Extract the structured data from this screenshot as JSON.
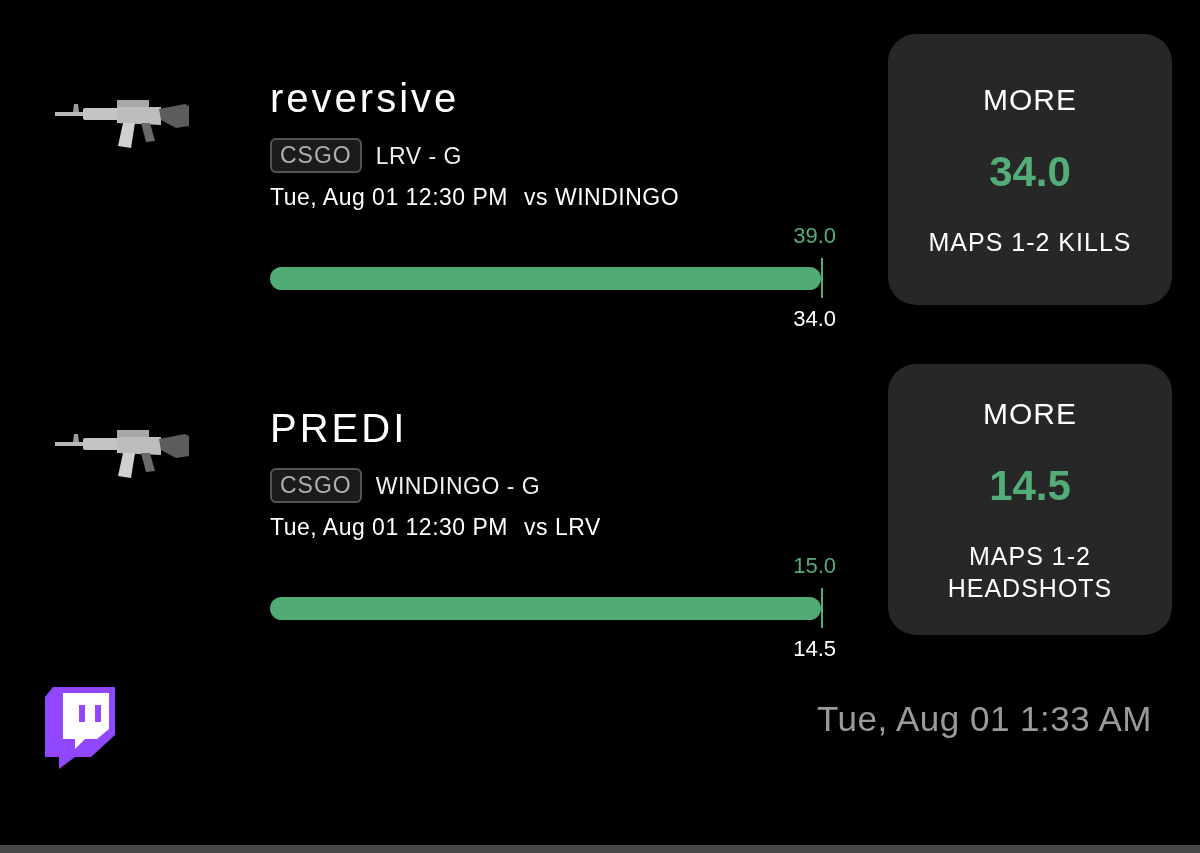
{
  "props": [
    {
      "player": "reversive",
      "game": "CSGO",
      "team": "LRV - G",
      "match_time": "Tue, Aug 01 12:30 PM",
      "opponent": "vs WINDINGO",
      "bar": {
        "top_value": "39.0",
        "level": 1,
        "bottom_value": "34.0"
      },
      "pick": {
        "direction": "MORE",
        "line": "34.0",
        "stat": "MAPS 1-2 KILLS"
      }
    },
    {
      "player": "PREDI",
      "game": "CSGO",
      "team": "WINDINGO - G",
      "match_time": "Tue, Aug 01 12:30 PM",
      "opponent": "vs LRV",
      "bar": {
        "top_value": "15.0",
        "level": 1,
        "bottom_value": "14.5"
      },
      "pick": {
        "direction": "MORE",
        "line": "14.5",
        "stat": "MAPS 1-2 HEADSHOTS"
      }
    }
  ],
  "timestamp": "Tue, Aug 01 1:33 AM"
}
